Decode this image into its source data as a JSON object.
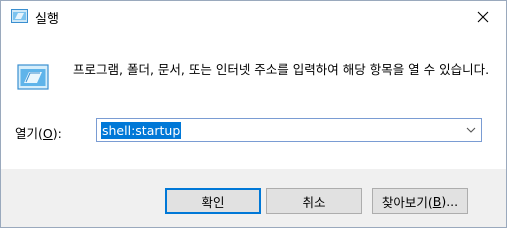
{
  "window": {
    "title": "실행",
    "description": "프로그램, 폴더, 문서, 또는 인터넷 주소를 입력하여 해당 항목을 열 수 있습니다."
  },
  "open": {
    "label_prefix": "열기(",
    "label_hotkey": "O",
    "label_suffix": "):",
    "value": "shell:startup"
  },
  "buttons": {
    "ok": "확인",
    "cancel": "취소",
    "browse_prefix": "찾아보기(",
    "browse_hotkey": "B",
    "browse_suffix": ")..."
  },
  "icons": {
    "title": "run-icon",
    "main": "run-icon",
    "close": "close-icon",
    "dropdown": "chevron-down-icon"
  },
  "colors": {
    "accent": "#0078d7",
    "footer_bg": "#f0f0f0"
  }
}
